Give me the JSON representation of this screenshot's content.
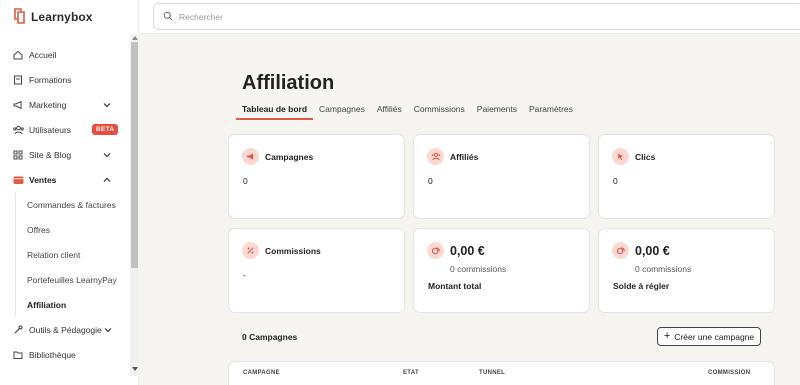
{
  "brand": {
    "name": "Learnybox"
  },
  "search": {
    "placeholder": "Rechercher"
  },
  "sidebar": {
    "items": [
      {
        "label": "Accueil",
        "icon": "home-icon"
      },
      {
        "label": "Formations",
        "icon": "book-icon"
      },
      {
        "label": "Marketing",
        "icon": "megaphone-icon"
      },
      {
        "label": "Utilisateurs",
        "icon": "users-icon",
        "badge": "BETA"
      },
      {
        "label": "Site & Blog",
        "icon": "grid-icon"
      },
      {
        "label": "Ventes",
        "icon": "wallet-icon"
      },
      {
        "label": "Outils & Pédagogie",
        "icon": "tools-icon"
      },
      {
        "label": "Bibliothèque",
        "icon": "folder-icon"
      }
    ],
    "sub_items": [
      {
        "label": "Commandes & factures"
      },
      {
        "label": "Offres"
      },
      {
        "label": "Relation client"
      },
      {
        "label": "Portefeuilles LearnyPay"
      },
      {
        "label": "Affiliation"
      }
    ]
  },
  "main": {
    "title": "Affiliation",
    "tabs": [
      {
        "label": "Tableau de bord"
      },
      {
        "label": "Campagnes"
      },
      {
        "label": "Affiliés"
      },
      {
        "label": "Commissions"
      },
      {
        "label": "Paiements"
      },
      {
        "label": "Paramètres"
      }
    ],
    "cards": {
      "campagnes": {
        "title": "Campagnes",
        "value": "0"
      },
      "affilies": {
        "title": "Affiliés",
        "value": "0"
      },
      "clics": {
        "title": "Clics",
        "value": "0"
      },
      "commissions": {
        "title": "Commissions",
        "value": "-"
      },
      "montant": {
        "value": "0,00 €",
        "sub": "0 commissions",
        "label": "Montant total"
      },
      "solde": {
        "value": "0,00 €",
        "sub": "0 commissions",
        "label": "Solde à régler"
      }
    },
    "campaign_count": "0 Campagnes",
    "create_button": "Créer une campagne",
    "table_headers": [
      "CAMPAGNE",
      "ETAT",
      "TUNNEL",
      "COMMISSION"
    ]
  },
  "colors": {
    "accent": "#e05a47",
    "icon_bg": "#fbd9d2",
    "badge": "#e84c3d",
    "background": "#f6f4f1"
  }
}
